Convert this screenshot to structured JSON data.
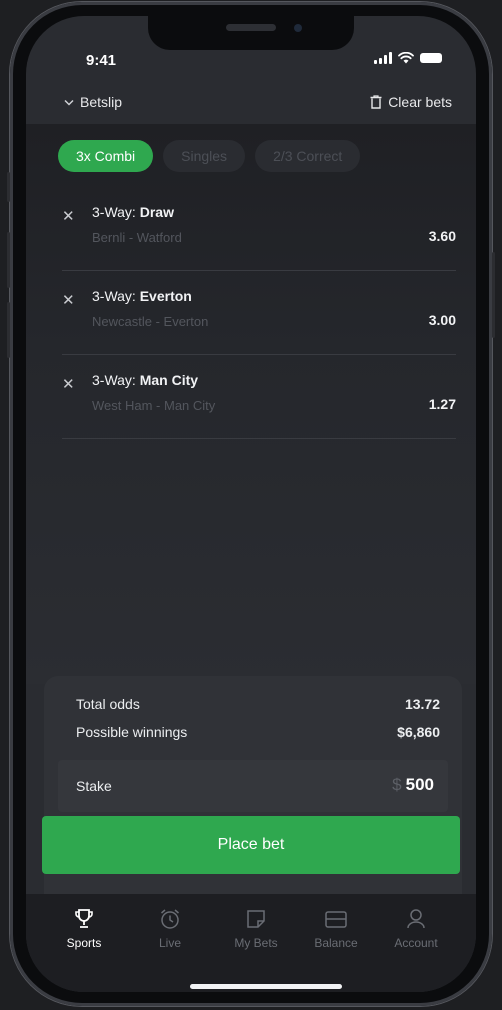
{
  "status": {
    "time": "9:41"
  },
  "header": {
    "title": "Betslip",
    "clear": "Clear bets"
  },
  "tabs": [
    {
      "label": "3x Combi",
      "active": true
    },
    {
      "label": "Singles",
      "active": false
    },
    {
      "label": "2/3 Correct",
      "active": false
    }
  ],
  "bets": [
    {
      "prefix": "3-Way: ",
      "pick": "Draw",
      "match": "Bernli - Watford",
      "odds": "3.60"
    },
    {
      "prefix": "3-Way: ",
      "pick": "Everton",
      "match": "Newcastle - Everton",
      "odds": "3.00"
    },
    {
      "prefix": "3-Way: ",
      "pick": "Man City",
      "match": "West Ham - Man City",
      "odds": "1.27"
    }
  ],
  "summary": {
    "total_odds_label": "Total odds",
    "total_odds_value": "13.72",
    "winnings_label": "Possible winnings",
    "winnings_value": "$6,860",
    "stake_label": "Stake",
    "stake_currency": "$",
    "stake_value": "500"
  },
  "place_bet": "Place bet",
  "nav": [
    {
      "label": "Sports",
      "icon": "trophy-icon",
      "active": true
    },
    {
      "label": "Live",
      "icon": "alarm-clock-icon",
      "active": false
    },
    {
      "label": "My Bets",
      "icon": "note-icon",
      "active": false
    },
    {
      "label": "Balance",
      "icon": "wallet-icon",
      "active": false
    },
    {
      "label": "Account",
      "icon": "user-icon",
      "active": false
    }
  ],
  "colors": {
    "accent": "#2fa84f",
    "background": "#2a2c31"
  }
}
